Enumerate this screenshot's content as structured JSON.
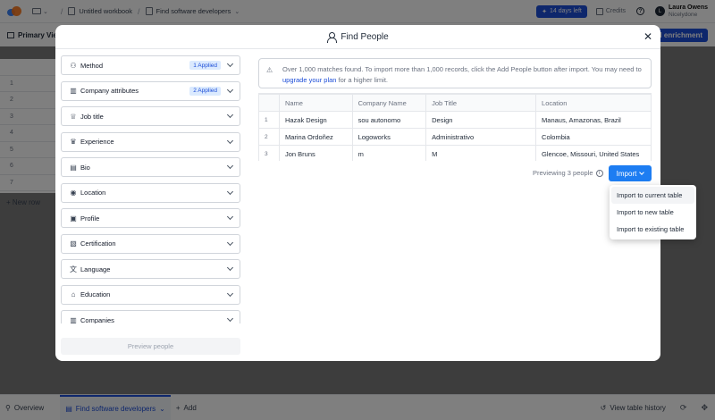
{
  "topbar": {
    "breadcrumb": [
      "Untitled workbook",
      "Find software developers"
    ],
    "trial_label": "14 days left",
    "credits_label": "Credits",
    "user_name": "Laura Owens",
    "user_org": "Nicelydone",
    "user_initial": "L"
  },
  "viewbar": {
    "view_label": "Primary View",
    "enrich_label": "Add enrichment"
  },
  "grid_bg": {
    "rows": [
      "1",
      "2",
      "3",
      "4",
      "5",
      "6",
      "7"
    ],
    "new_row_label": "New row"
  },
  "bottombar": {
    "overview_label": "Overview",
    "active_tab_label": "Find software developers",
    "add_label": "Add",
    "history_label": "View table history"
  },
  "modal": {
    "title": "Find People",
    "filters": [
      {
        "icon": "method-icon",
        "glyph": "⚇",
        "label": "Method",
        "badge": "1 Applied"
      },
      {
        "icon": "company-icon",
        "glyph": "▥",
        "label": "Company attributes",
        "badge": "2 Applied"
      },
      {
        "icon": "crown-icon",
        "glyph": "♕",
        "label": "Job title",
        "badge": ""
      },
      {
        "icon": "trophy-icon",
        "glyph": "♛",
        "label": "Experience",
        "badge": ""
      },
      {
        "icon": "id-card-icon",
        "glyph": "▤",
        "label": "Bio",
        "badge": ""
      },
      {
        "icon": "location-pin-icon",
        "glyph": "◉",
        "label": "Location",
        "badge": ""
      },
      {
        "icon": "profile-icon",
        "glyph": "▣",
        "label": "Profile",
        "badge": ""
      },
      {
        "icon": "certificate-icon",
        "glyph": "▧",
        "label": "Certification",
        "badge": ""
      },
      {
        "icon": "language-icon",
        "glyph": "文",
        "label": "Language",
        "badge": ""
      },
      {
        "icon": "graduation-cap-icon",
        "glyph": "⌂",
        "label": "Education",
        "badge": ""
      },
      {
        "icon": "companies-icon",
        "glyph": "▥",
        "label": "Companies",
        "badge": ""
      }
    ],
    "preview_button": "Preview people",
    "notice_text_1": "Over 1,000 matches found. To import more than 1,000 records, click the Add People button after import. You may need to ",
    "notice_link": "upgrade your plan",
    "notice_text_2": " for a higher limit.",
    "table": {
      "columns": [
        "",
        "Name",
        "Company Name",
        "Job Title",
        "Location"
      ],
      "rows": [
        [
          "1",
          "Hazak Design",
          "sou autonomo",
          "Design",
          "Manaus, Amazonas, Brazil"
        ],
        [
          "2",
          "Marina Ordoñez",
          "Logoworks",
          "Administrativo",
          "Colombia"
        ],
        [
          "3",
          "Jon Bruns",
          "m",
          "M",
          "Glencoe, Missouri, United States"
        ]
      ]
    },
    "preview_count_label": "Previewing 3 people",
    "import_button": "Import",
    "import_menu": [
      "Import to current table",
      "Import to new table",
      "Import to existing table"
    ]
  }
}
